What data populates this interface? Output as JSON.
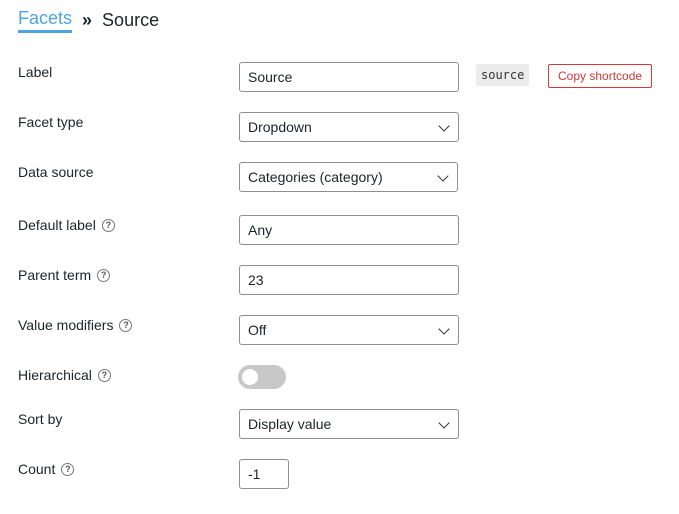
{
  "breadcrumb": {
    "parent": "Facets",
    "separator": "»",
    "current": "Source"
  },
  "fields": {
    "label": {
      "label": "Label",
      "value": "Source",
      "code": "source",
      "copy_button": "Copy shortcode"
    },
    "facet_type": {
      "label": "Facet type",
      "value": "Dropdown"
    },
    "data_source": {
      "label": "Data source",
      "value": "Categories (category)"
    },
    "default_label": {
      "label": "Default label",
      "value": "Any",
      "help": "?"
    },
    "parent_term": {
      "label": "Parent term",
      "value": "23",
      "help": "?"
    },
    "value_modifiers": {
      "label": "Value modifiers",
      "value": "Off",
      "help": "?"
    },
    "hierarchical": {
      "label": "Hierarchical",
      "help": "?",
      "enabled": false
    },
    "sort_by": {
      "label": "Sort by",
      "value": "Display value"
    },
    "count": {
      "label": "Count",
      "value": "-1",
      "help": "?"
    }
  }
}
